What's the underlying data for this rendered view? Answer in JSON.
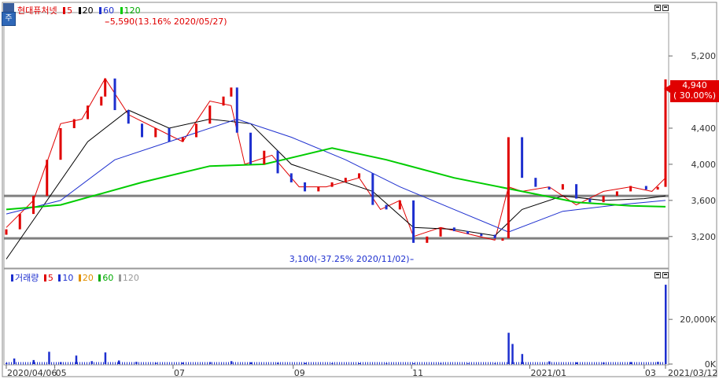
{
  "legend": {
    "name": "현대퓨처넷",
    "items": [
      {
        "label": "5",
        "color": "#e00000"
      },
      {
        "label": "20",
        "color": "#000000"
      },
      {
        "label": "60",
        "color": "#1d2fcf"
      },
      {
        "label": "120",
        "color": "#00cc00"
      }
    ]
  },
  "volume_legend": {
    "name": "거래량",
    "items": [
      {
        "label": "5",
        "color": "#e00000"
      },
      {
        "label": "10",
        "color": "#1d2fcf"
      },
      {
        "label": "20",
        "color": "#e09000"
      },
      {
        "label": "60",
        "color": "#00aa00"
      },
      {
        "label": "120",
        "color": "#999999"
      }
    ]
  },
  "corner_badge": "주",
  "price_tag": {
    "line1": "4,940",
    "line2": "( 30.00%)"
  },
  "annotations": {
    "high": "5,590(13.16% 2020/05/27)",
    "low": "3,100(-37.25% 2020/11/02)"
  },
  "colors": {
    "up": "#e00000",
    "down": "#1d2fcf",
    "ma5": "#e00000",
    "ma20": "#000000",
    "ma60": "#1d2fcf",
    "ma120": "#00cc00",
    "support": "#808080"
  },
  "chart_data": [
    {
      "type": "candlestick",
      "title": "현대퓨처넷",
      "y_ticks": [
        "5,200",
        "4,800",
        "4,400",
        "4,000",
        "3,600",
        "3,200"
      ],
      "ylim": [
        2850,
        5680
      ],
      "x_ticks": [
        "2020/04/06",
        "05",
        "07",
        "09",
        "11",
        "2021/01",
        "03",
        "2021/03/12"
      ],
      "x_tick_dates": [
        "2020-04-06",
        "2020-05-01",
        "2020-07-01",
        "2020-09-01",
        "2020-11-01",
        "2021-01-01",
        "2021-03-01",
        "2021-03-12"
      ],
      "horizontal_lines": [
        3650,
        3180
      ],
      "series": [
        {
          "name": "5",
          "type": "line",
          "x": [
            "2020-04-06",
            "2020-04-20",
            "2020-05-04",
            "2020-05-15",
            "2020-05-27",
            "2020-06-08",
            "2020-06-22",
            "2020-07-06",
            "2020-07-20",
            "2020-07-31",
            "2020-08-07",
            "2020-08-21",
            "2020-09-04",
            "2020-09-18",
            "2020-10-05",
            "2020-10-16",
            "2020-10-26",
            "2020-11-02",
            "2020-11-16",
            "2020-11-30",
            "2020-12-14",
            "2020-12-21",
            "2020-12-28",
            "2021-01-11",
            "2021-01-25",
            "2021-02-08",
            "2021-02-22",
            "2021-03-05",
            "2021-03-12"
          ],
          "values": [
            3300,
            3600,
            4450,
            4500,
            4950,
            4550,
            4400,
            4250,
            4700,
            4650,
            4000,
            4100,
            3750,
            3750,
            3850,
            3500,
            3600,
            3200,
            3300,
            3230,
            3160,
            3750,
            3700,
            3750,
            3550,
            3700,
            3750,
            3700,
            3850
          ]
        },
        {
          "name": "20",
          "type": "line",
          "x": [
            "2020-04-06",
            "2020-04-27",
            "2020-05-18",
            "2020-06-08",
            "2020-06-29",
            "2020-07-20",
            "2020-08-10",
            "2020-08-31",
            "2020-09-21",
            "2020-10-12",
            "2020-11-02",
            "2020-11-23",
            "2020-12-14",
            "2020-12-28",
            "2021-01-18",
            "2021-02-08",
            "2021-03-01",
            "2021-03-12"
          ],
          "values": [
            2950,
            3600,
            4250,
            4600,
            4400,
            4500,
            4450,
            4000,
            3850,
            3700,
            3300,
            3280,
            3210,
            3500,
            3650,
            3600,
            3620,
            3650
          ]
        },
        {
          "name": "60",
          "type": "line",
          "x": [
            "2020-04-06",
            "2020-05-04",
            "2020-06-01",
            "2020-07-06",
            "2020-08-03",
            "2020-08-31",
            "2020-09-28",
            "2020-10-26",
            "2020-11-23",
            "2020-12-21",
            "2021-01-18",
            "2021-02-15",
            "2021-03-12"
          ],
          "values": [
            3450,
            3600,
            4050,
            4300,
            4500,
            4300,
            4050,
            3750,
            3500,
            3250,
            3480,
            3550,
            3600
          ]
        },
        {
          "name": "120",
          "type": "line",
          "x": [
            "2020-04-06",
            "2020-05-04",
            "2020-06-15",
            "2020-07-20",
            "2020-08-17",
            "2020-09-21",
            "2020-10-19",
            "2020-11-23",
            "2020-12-28",
            "2021-01-25",
            "2021-02-22",
            "2021-03-12"
          ],
          "values": [
            3500,
            3550,
            3800,
            3980,
            4000,
            4180,
            4050,
            3850,
            3700,
            3580,
            3540,
            3530
          ]
        },
        {
          "name": "종가",
          "type": "bar",
          "x": [
            "2020-04-06",
            "2020-04-13",
            "2020-04-20",
            "2020-04-27",
            "2020-05-04",
            "2020-05-11",
            "2020-05-18",
            "2020-05-25",
            "2020-05-27",
            "2020-06-01",
            "2020-06-08",
            "2020-06-15",
            "2020-06-22",
            "2020-06-29",
            "2020-07-06",
            "2020-07-13",
            "2020-07-20",
            "2020-07-27",
            "2020-07-31",
            "2020-08-03",
            "2020-08-10",
            "2020-08-17",
            "2020-08-24",
            "2020-08-31",
            "2020-09-07",
            "2020-09-14",
            "2020-09-21",
            "2020-09-28",
            "2020-10-05",
            "2020-10-12",
            "2020-10-19",
            "2020-10-26",
            "2020-11-02",
            "2020-11-09",
            "2020-11-16",
            "2020-11-23",
            "2020-11-30",
            "2020-12-07",
            "2020-12-14",
            "2020-12-18",
            "2020-12-21",
            "2020-12-28",
            "2021-01-04",
            "2021-01-11",
            "2021-01-18",
            "2021-01-25",
            "2021-02-01",
            "2021-02-08",
            "2021-02-15",
            "2021-02-22",
            "2021-03-02",
            "2021-03-08",
            "2021-03-12"
          ],
          "values": [
            3280,
            3450,
            3650,
            4050,
            4400,
            4500,
            4650,
            4750,
            4950,
            4600,
            4450,
            4300,
            4400,
            4250,
            4300,
            4450,
            4650,
            4750,
            4850,
            4350,
            4000,
            4150,
            3900,
            3800,
            3700,
            3750,
            3800,
            3850,
            3900,
            3550,
            3500,
            3600,
            3130,
            3200,
            3300,
            3260,
            3230,
            3220,
            3180,
            3180,
            4300,
            3850,
            3750,
            3720,
            3780,
            3620,
            3580,
            3650,
            3700,
            3760,
            3720,
            3750,
            4940
          ]
        }
      ]
    },
    {
      "type": "bar",
      "title": "거래량",
      "y_ticks": [
        "20,000K",
        "0K"
      ],
      "ylim": [
        0,
        38000
      ],
      "x": [
        "2020-04-06",
        "2020-04-10",
        "2020-04-20",
        "2020-04-28",
        "2020-05-04",
        "2020-05-12",
        "2020-05-20",
        "2020-05-27",
        "2020-06-03",
        "2020-06-12",
        "2020-06-22",
        "2020-07-06",
        "2020-07-20",
        "2020-07-31",
        "2020-08-10",
        "2020-08-24",
        "2020-09-07",
        "2020-09-21",
        "2020-10-05",
        "2020-10-19",
        "2020-11-02",
        "2020-11-16",
        "2020-11-30",
        "2020-12-14",
        "2020-12-21",
        "2020-12-23",
        "2020-12-28",
        "2021-01-11",
        "2021-01-25",
        "2021-02-08",
        "2021-02-22",
        "2021-03-08",
        "2021-03-12"
      ],
      "values": [
        500,
        2500,
        1800,
        5500,
        900,
        3800,
        1300,
        5200,
        1600,
        1000,
        600,
        700,
        900,
        1300,
        800,
        600,
        500,
        400,
        400,
        300,
        300,
        250,
        250,
        300,
        14000,
        9000,
        4500,
        1200,
        800,
        700,
        900,
        1000,
        35500
      ]
    }
  ]
}
